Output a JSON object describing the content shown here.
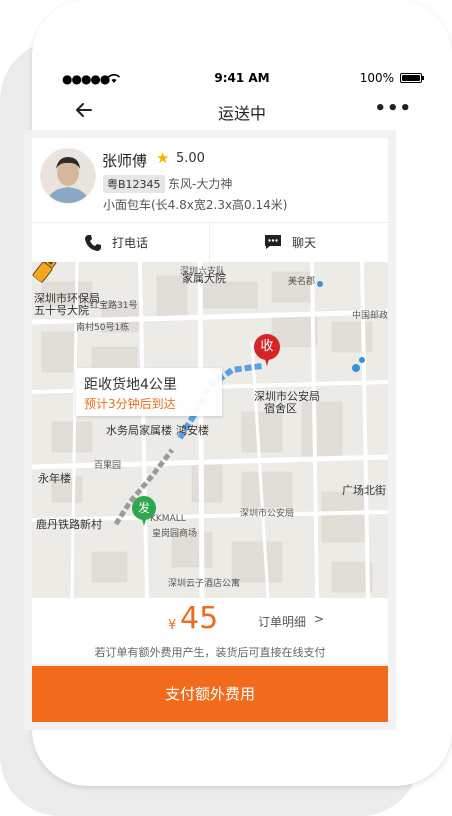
{
  "status_bar": {
    "signal": "●●●●●",
    "time": "9:41 AM",
    "battery": "100%"
  },
  "nav": {
    "title": "运送中"
  },
  "driver": {
    "name": "张师傅",
    "rating": "5.00",
    "plate": "粤B12345",
    "vehicle_model": "东风-大力神",
    "vehicle_spec": "小面包车(长4.8x宽2.3x高0.14米)"
  },
  "contact": {
    "call_label": "打电话",
    "chat_label": "聊天"
  },
  "map": {
    "labels": {
      "l1": "深圳市公安局",
      "l2": "宿舍区",
      "l3": "水务局家属楼",
      "l4": "鸿安楼",
      "l5": "永年楼",
      "l6": "广场北街",
      "l7": "深圳市环保局",
      "l8": "五十号大院",
      "l9": "家属大院",
      "l10": "鹿丹铁路新村",
      "l11": "深圳市公安局",
      "l12": "深圳六支队",
      "l13": "红宝路31号",
      "l14": "南村50号1栋",
      "l15": "百果园",
      "l16": "KKMALL",
      "l17": "皇岗园商场",
      "l18": "深圳云子酒店公寓",
      "l19": "美名郡",
      "l20": "中国邮政"
    },
    "receive_pin": "收",
    "send_pin": "发",
    "bubble_distance": "距收货地4公里",
    "bubble_eta": "预计3分钟后到达"
  },
  "fee": {
    "currency": "¥",
    "amount": "45",
    "detail_label": "订单明细",
    "note": "若订单有额外费用产生，装货后可直接在线支付"
  },
  "pay_button": "支付额外费用"
}
